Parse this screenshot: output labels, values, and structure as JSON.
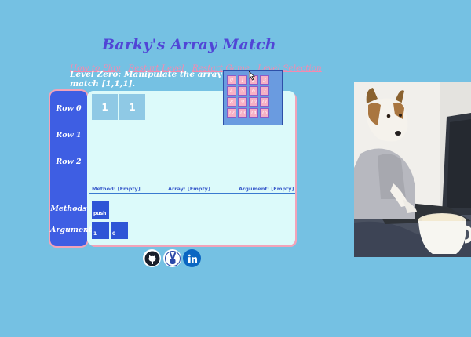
{
  "title": "Barky's Array Match",
  "nav": [
    "How to Play",
    "Restart Level",
    "Restart Game",
    "Level Selection"
  ],
  "level_description": "Level Zero: Manipulate the array to match [1,1,1].",
  "rows": [
    "Row 0",
    "Row 1",
    "Row 2"
  ],
  "row0_cells": [
    "1",
    "1"
  ],
  "status": {
    "method": "Method: [Empty]",
    "array": "Array: [Empty]",
    "argument": "Argument: [Empty]"
  },
  "side_labels": {
    "methods": "Methods",
    "arguments": "Arguments"
  },
  "methods": [
    "push"
  ],
  "arguments": [
    "1",
    "0"
  ],
  "level_buttons": [
    "0",
    "1",
    "2",
    "3",
    "4",
    "5",
    "6",
    "7",
    "8",
    "9",
    "10",
    "11",
    "12",
    "13",
    "14",
    "15"
  ],
  "social_icons": [
    "github-icon",
    "peace-sign-icon",
    "linkedin-icon"
  ],
  "colors": {
    "background": "#75c1e3",
    "title": "#5146d6",
    "nav": "#f28bb0",
    "panel": "#dcfafa",
    "side": "#3e5ee3",
    "cell": "#8fc9e5",
    "chip": "#2f55d6"
  }
}
